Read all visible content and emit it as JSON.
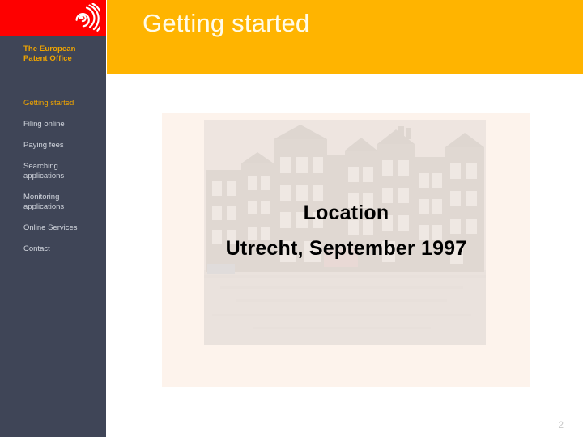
{
  "header": {
    "title": "Getting started",
    "logo_icon": "epo-spiral-logo-icon",
    "brand_line_1": "The European",
    "brand_line_2": "Patent Office",
    "band_color": "#ffb400",
    "logo_band_color": "#fe0000",
    "title_color": "#fffbe8"
  },
  "sidebar": {
    "background_color": "#3f4557",
    "active_color": "#f0a500",
    "item_color": "#d2d6de",
    "items": [
      {
        "label": "Getting started",
        "line_1": "Getting started",
        "line_2": "",
        "active": true
      },
      {
        "label": "Filing online",
        "line_1": "Filing online",
        "line_2": "",
        "active": false
      },
      {
        "label": "Paying fees",
        "line_1": "Paying fees",
        "line_2": "",
        "active": false
      },
      {
        "label": "Searching applications",
        "line_1": "Searching",
        "line_2": "applications",
        "active": false
      },
      {
        "label": "Monitoring applications",
        "line_1": "Monitoring",
        "line_2": "applications",
        "active": false
      },
      {
        "label": "Online Services",
        "line_1": "Online Services",
        "line_2": "",
        "active": false
      },
      {
        "label": "Contact",
        "line_1": "Contact",
        "line_2": "",
        "active": false
      }
    ]
  },
  "main": {
    "panel_color": "#fdf3ec",
    "photo_alt": "faded photograph of Amsterdam canal houses along the water",
    "heading": "Location",
    "subheading": "Utrecht, September 1997",
    "text_color": "#000000"
  },
  "footer": {
    "page_number": "2",
    "page_number_color": "#c9c9c9"
  }
}
